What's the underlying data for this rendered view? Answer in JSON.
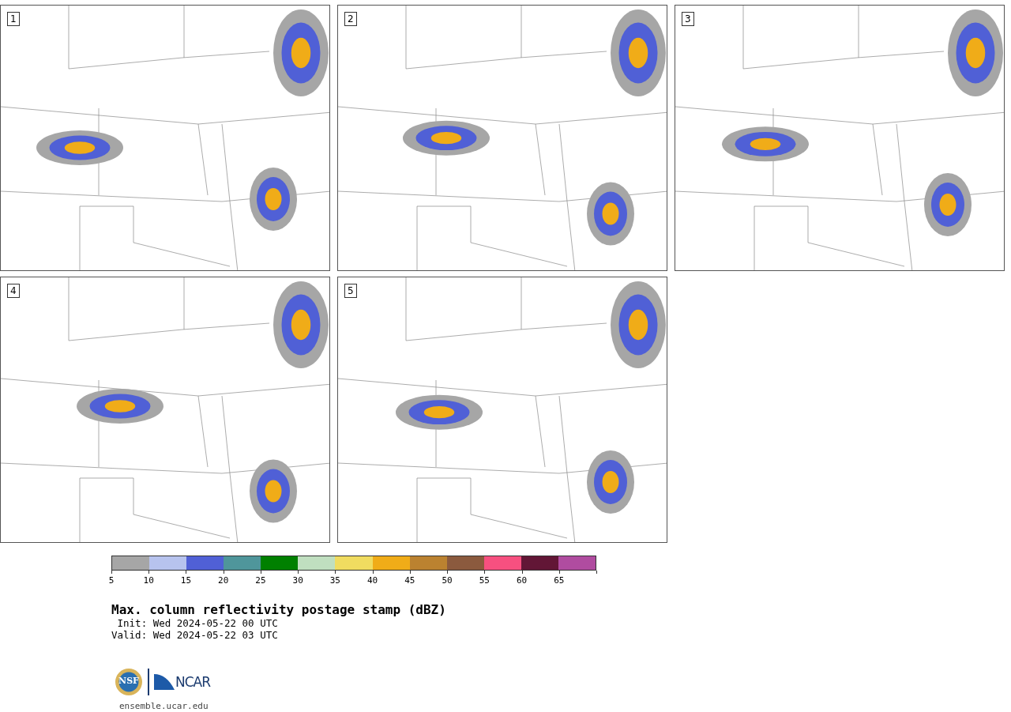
{
  "panels": [
    {
      "label": "1"
    },
    {
      "label": "2"
    },
    {
      "label": "3"
    },
    {
      "label": "4"
    },
    {
      "label": "5"
    }
  ],
  "colorbar": {
    "bins": [
      {
        "color": "#a6a6a6"
      },
      {
        "color": "#b7c3ee"
      },
      {
        "color": "#5060d6"
      },
      {
        "color": "#4f969b"
      },
      {
        "color": "#008000"
      },
      {
        "color": "#c0dfc0"
      },
      {
        "color": "#f0dc60"
      },
      {
        "color": "#f0ac18"
      },
      {
        "color": "#bb8230"
      },
      {
        "color": "#8b5a3e"
      },
      {
        "color": "#f75080"
      },
      {
        "color": "#621636"
      },
      {
        "color": "#b04ca0"
      }
    ],
    "ticks": [
      "5",
      "10",
      "15",
      "20",
      "25",
      "30",
      "35",
      "40",
      "45",
      "50",
      "55",
      "60",
      "65"
    ]
  },
  "title": "Max. column reflectivity postage stamp (dBZ)",
  "init": " Init: Wed 2024-05-22 00 UTC",
  "valid": "Valid: Wed 2024-05-22 03 UTC",
  "logos": {
    "seal_text": "NSF",
    "org_text": "NCAR"
  },
  "url": "ensemble.ucar.edu"
}
